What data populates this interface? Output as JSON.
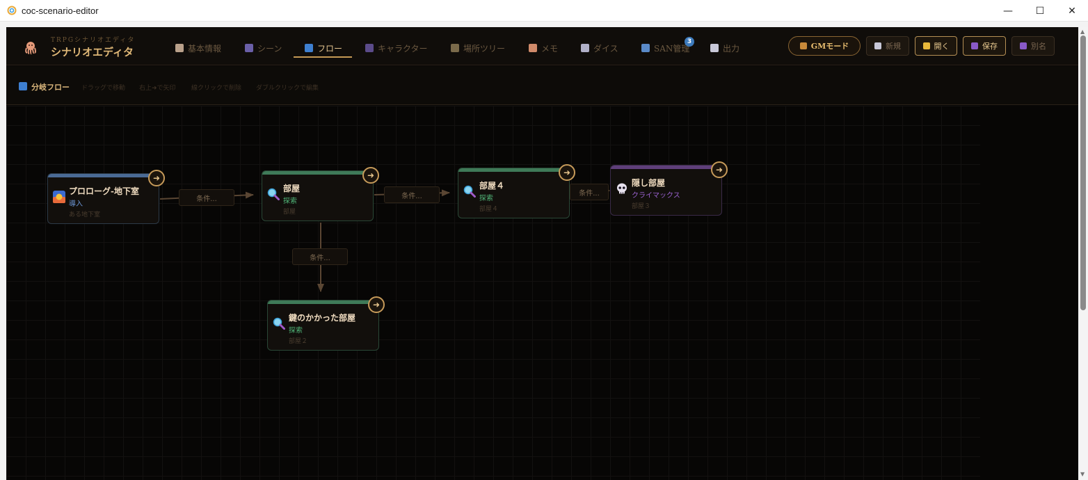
{
  "window": {
    "title": "coc-scenario-editor",
    "controls": {
      "minimize": "—",
      "maximize": "☐",
      "close": "✕"
    }
  },
  "brand": {
    "subtitle": "TRPGシナリオエディタ",
    "title": "シナリオエディタ",
    "logo_icon": "octopus-icon"
  },
  "tabs": [
    {
      "label": "基本情報",
      "icon": "memo-icon",
      "color": "#b9a08a"
    },
    {
      "label": "シーン",
      "icon": "clapper-icon",
      "color": "#6a5fa8"
    },
    {
      "label": "フロー",
      "icon": "shuffle-icon",
      "color": "#3e7fd0",
      "active": true
    },
    {
      "label": "キャラクター",
      "icon": "people-icon",
      "color": "#5b4b8a"
    },
    {
      "label": "場所ツリー",
      "icon": "map-icon",
      "color": "#7a6a4a"
    },
    {
      "label": "メモ",
      "icon": "note-icon",
      "color": "#d08a6a"
    },
    {
      "label": "ダイス",
      "icon": "dice-icon",
      "color": "#b0b0c8"
    },
    {
      "label": "SAN管理",
      "icon": "chart-icon",
      "color": "#5a8ac8",
      "badge": "3"
    },
    {
      "label": "出力",
      "icon": "page-icon",
      "color": "#c8c8d8"
    }
  ],
  "buttons": {
    "gm_mode": "GMモード",
    "new": "新規",
    "open": "開く",
    "save": "保存",
    "save_as": "別名"
  },
  "toolbar": {
    "title": "分岐フロー",
    "hints": [
      "ドラッグで移動",
      "右上➜で矢印",
      "線クリックで削除",
      "ダブルクリックで編集"
    ]
  },
  "condition_label": "条件...",
  "nodes": [
    {
      "name": "プロローグ-地下室",
      "type": "導入",
      "location": "ある地下室",
      "bar_color": "#4a6a95",
      "type_color": "#6d98d8",
      "border": "#2d3a48",
      "icon": "sunrise-icon"
    },
    {
      "name": "部屋",
      "type": "探索",
      "location": "部屋",
      "bar_color": "#3f7a58",
      "type_color": "#52b87a",
      "border": "#2a4736",
      "icon": "magnifier-icon"
    },
    {
      "name": "部屋４",
      "type": "探索",
      "location": "部屋４",
      "bar_color": "#3f7a58",
      "type_color": "#52b87a",
      "border": "#2a4736",
      "icon": "magnifier-icon"
    },
    {
      "name": "隠し部屋",
      "type": "クライマックス",
      "location": "部屋３",
      "bar_color": "#5f3f7a",
      "type_color": "#9a62d0",
      "border": "#3a2a48",
      "icon": "skull-icon"
    },
    {
      "name": "鍵のかかった部屋",
      "type": "探索",
      "location": "部屋２",
      "bar_color": "#3f7a58",
      "type_color": "#52b87a",
      "border": "#2a4736",
      "icon": "magnifier-icon"
    }
  ],
  "colors": {
    "accent": "#c59a55",
    "background": "#070605",
    "edge": "#5a4633"
  }
}
